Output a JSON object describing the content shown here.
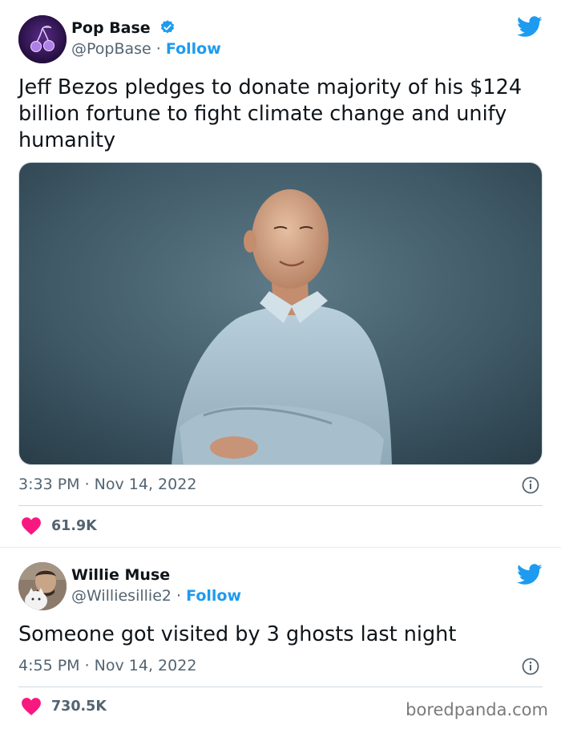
{
  "tweets": [
    {
      "author_name": "Pop Base",
      "handle": "@PopBase",
      "separator": "·",
      "follow_label": "Follow",
      "verified": true,
      "text": "Jeff Bezos pledges to donate majority of his $124 billion fortune to fight climate change and unify humanity",
      "timestamp": "3:33 PM · Nov 14, 2022",
      "likes": "61.9K",
      "has_photo": true
    },
    {
      "author_name": "Willie Muse",
      "handle": "@Williesillie2",
      "separator": "·",
      "follow_label": "Follow",
      "verified": false,
      "text": "Someone got visited by 3 ghosts last night",
      "timestamp": "4:55 PM · Nov 14, 2022",
      "likes": "730.5K",
      "has_photo": false
    }
  ],
  "watermark": "boredpanda.com",
  "icons": {
    "bird": "twitter-bird-icon",
    "info": "info-icon",
    "heart": "heart-icon",
    "verified": "verified-badge-icon"
  },
  "colors": {
    "twitter_blue": "#1d9bf0",
    "heart_pink": "#f91880",
    "text_primary": "#0f1419",
    "text_secondary": "#536471"
  }
}
